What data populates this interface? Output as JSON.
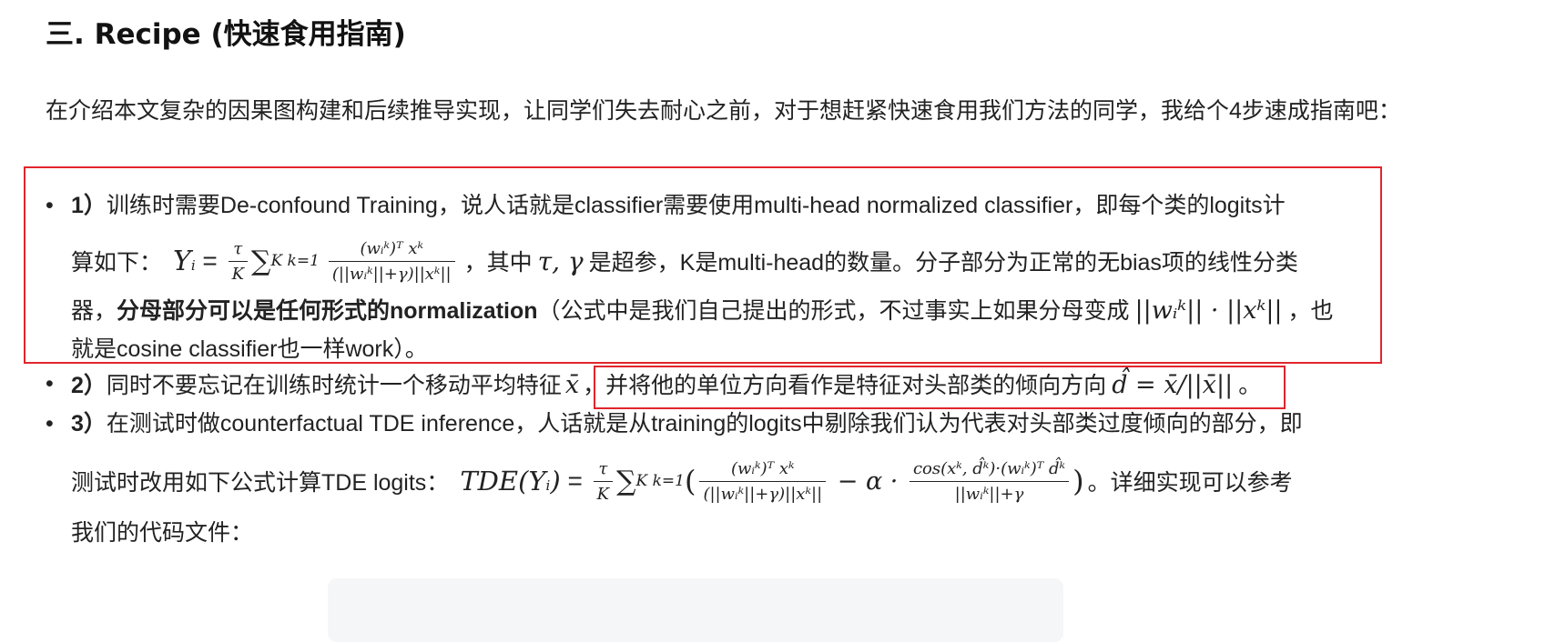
{
  "heading": "三. Recipe (快速食用指南)",
  "intro": "在介绍本文复杂的因果图构建和后续推导实现，让同学们失去耐心之前，对于想赶紧快速食用我们方法的同学，我给个4步速成指南吧：",
  "items": [
    {
      "marker": "1）",
      "line1": "训练时需要De-confound Training，说人话就是classifier需要使用multi-head normalized classifier，即每个类的logits计",
      "line2_prefix": "算如下：",
      "formula_lhs": "Y",
      "formula_lhs_sub": "i",
      "formula_eq": " = ",
      "formula_tauK_num": "τ",
      "formula_tauK_den": "K",
      "formula_sum": "∑",
      "formula_sum_range": "K k=1",
      "formula_frac_num": "(wᵢᵏ)ᵀ xᵏ",
      "formula_frac_den": "(||wᵢᵏ||+γ)||xᵏ||",
      "line2_suffix_a": "，其中",
      "params": "τ, γ",
      "line2_suffix_b": "是超参，K是multi-head的数量。分子部分为正常的无bias项的线性分类",
      "line3_prefix": "器，",
      "line3_bold": "分母部分可以是任何形式的normalization",
      "line3_rest": "（公式中是我们自己提出的形式，不过事实上如果分母变成",
      "line3_math": "||wᵢᵏ|| · ||xᵏ||",
      "line3_end": "，也",
      "line4": "就是cosine classifier也一样work）。"
    },
    {
      "marker": "2）",
      "text_a": "同时不要忘记在训练时统计一个移动平均特征",
      "math_a": "x̄",
      "text_b": "，",
      "text_c": "并将他的单位方向看作是特征对头部类的倾向方向",
      "math_b": "d̂ = x̄/||x̄||",
      "text_d": "。"
    },
    {
      "marker": "3）",
      "line1": "在测试时做counterfactual TDE inference，人话就是从training的logits中剔除我们认为代表对头部类过度倾向的部分，即",
      "line2_prefix": "测试时改用如下公式计算TDE logits：",
      "formula_lhs": "TDE(Y",
      "formula_lhs_sub": "i",
      "formula_lhs_close": ")",
      "formula_eq": " = ",
      "formula_tauK_num": "τ",
      "formula_tauK_den": "K",
      "formula_sum": "∑",
      "formula_sum_range": "K k=1",
      "formula_open": "(",
      "frac1_num": "(wᵢᵏ)ᵀ xᵏ",
      "frac1_den": "(||wᵢᵏ||+γ)||xᵏ||",
      "minus_alpha": " − α · ",
      "frac2_num": "cos(xᵏ, d̂ᵏ)·(wᵢᵏ)ᵀ d̂ᵏ",
      "frac2_den": "||wᵢᵏ||+γ",
      "formula_close": ")",
      "line2_suffix": "。详细实现可以参考",
      "line3": "我们的代码文件："
    }
  ],
  "colors": {
    "highlight_border": "#e0262b",
    "code_bg": "#f5f6f7"
  }
}
